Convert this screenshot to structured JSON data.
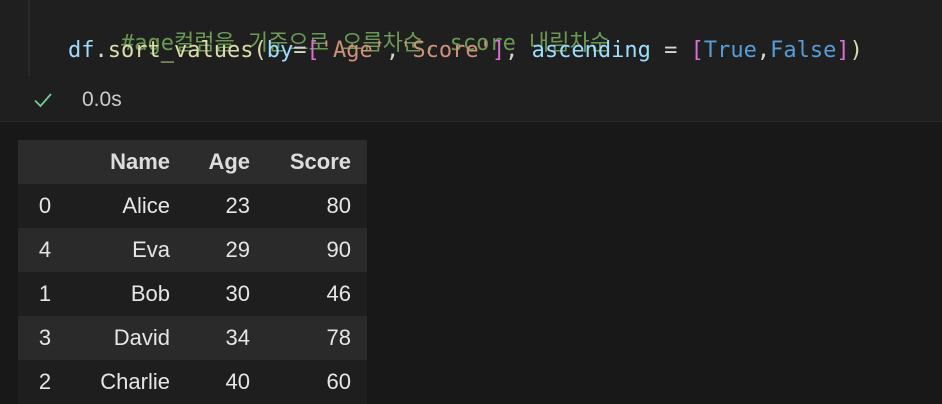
{
  "code_cell": {
    "line1_comment": "#age컬럼을 기준으로 오름차순, score 내림차순",
    "line2": {
      "obj": "df",
      "dot": ".",
      "method": "sort_values",
      "paren_open": "(",
      "kwarg1": "by",
      "eq1": "=",
      "list_open": "[",
      "str1": "'Age'",
      "comma1": ",",
      "str2": "'Score'",
      "list_close": "]",
      "comma2": ", ",
      "kwarg2": "ascending",
      "eq2": " = ",
      "list2_open": "[",
      "bool1": "True",
      "comma3": ",",
      "bool2": "False",
      "list2_close": "]",
      "paren_close": ")"
    }
  },
  "status": {
    "icon": "check-icon",
    "time": "0.0s",
    "color": "#73c991"
  },
  "dataframe": {
    "columns": [
      "",
      "Name",
      "Age",
      "Score"
    ],
    "rows": [
      {
        "index": "0",
        "Name": "Alice",
        "Age": "23",
        "Score": "80"
      },
      {
        "index": "4",
        "Name": "Eva",
        "Age": "29",
        "Score": "90"
      },
      {
        "index": "1",
        "Name": "Bob",
        "Age": "30",
        "Score": "46"
      },
      {
        "index": "3",
        "Name": "David",
        "Age": "34",
        "Score": "78"
      },
      {
        "index": "2",
        "Name": "Charlie",
        "Age": "40",
        "Score": "60"
      }
    ]
  }
}
